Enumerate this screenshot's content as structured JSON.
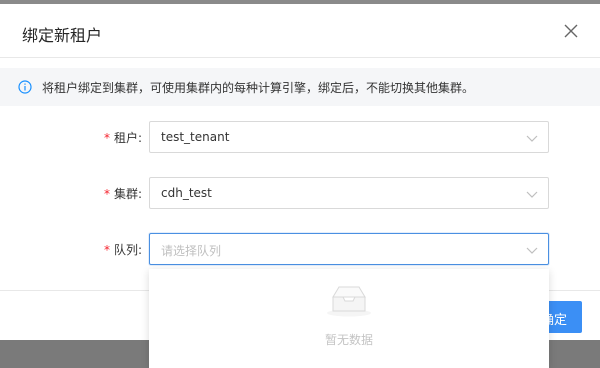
{
  "modal": {
    "title": "绑定新租户",
    "info": "将租户绑定到集群，可使用集群内的每种计算引擎，绑定后，不能切换其他集群。",
    "confirm_label": "确定"
  },
  "form": {
    "required_mark": "*",
    "tenant": {
      "label": "租户:",
      "value": "test_tenant"
    },
    "cluster": {
      "label": "集群:",
      "value": "cdh_test"
    },
    "queue": {
      "label": "队列:",
      "placeholder": "请选择队列"
    }
  },
  "dropdown": {
    "empty_text": "暂无数据"
  },
  "icons": {
    "close": "close-icon",
    "info": "info-circle-icon",
    "chevron": "chevron-down-icon",
    "empty": "empty-inbox-icon"
  },
  "colors": {
    "primary": "#3b8ff5",
    "required": "#f5222d",
    "info": "#1890ff"
  }
}
